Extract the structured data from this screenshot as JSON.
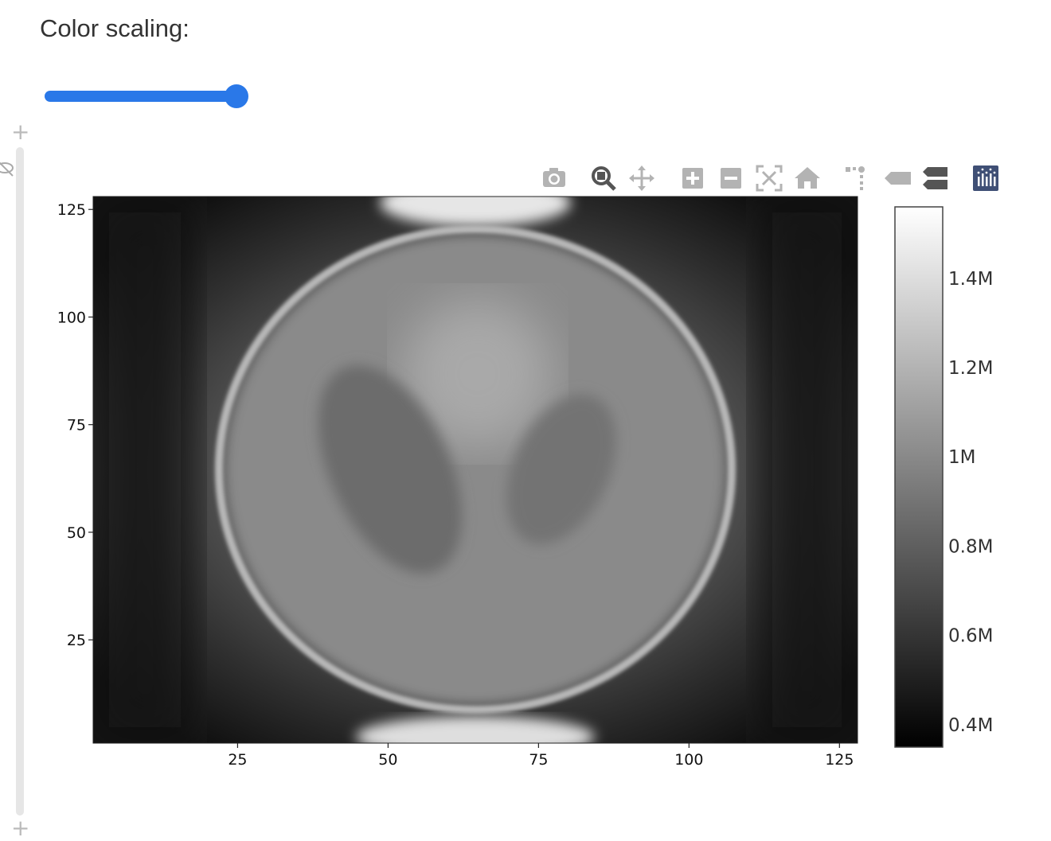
{
  "header": {
    "title": "Color scaling:"
  },
  "slider": {
    "value_fraction": 1.0,
    "accent": "#2a78e8"
  },
  "modebar": {
    "icons": [
      {
        "name": "camera-icon",
        "active": false
      },
      {
        "name": "zoom-icon",
        "active": true
      },
      {
        "name": "pan-icon",
        "active": false
      },
      {
        "name": "zoom-in-icon",
        "active": false
      },
      {
        "name": "zoom-out-icon",
        "active": false
      },
      {
        "name": "autoscale-icon",
        "active": false
      },
      {
        "name": "home-icon",
        "active": false
      },
      {
        "name": "spike-lines-icon",
        "active": false
      },
      {
        "name": "hover-closest-icon",
        "active": false
      },
      {
        "name": "hover-compare-icon",
        "active": false
      },
      {
        "name": "plotly-logo-icon",
        "active": false
      }
    ]
  },
  "chart_data": {
    "type": "heatmap",
    "colorscale": "greys",
    "x_ticks": [
      "25",
      "50",
      "75",
      "100",
      "125"
    ],
    "y_ticks": [
      "25",
      "50",
      "75",
      "100",
      "125"
    ],
    "xlim": [
      1,
      128
    ],
    "ylim": [
      1,
      128
    ],
    "colorbar": {
      "range": [
        350000,
        1560000
      ],
      "tick_values": [
        400000,
        600000,
        800000,
        1000000,
        1200000,
        1400000
      ],
      "tick_labels": [
        "0.4M",
        "0.6M",
        "0.8M",
        "1M",
        "1.2M",
        "1.4M"
      ]
    },
    "grid": false,
    "legend": "none"
  }
}
